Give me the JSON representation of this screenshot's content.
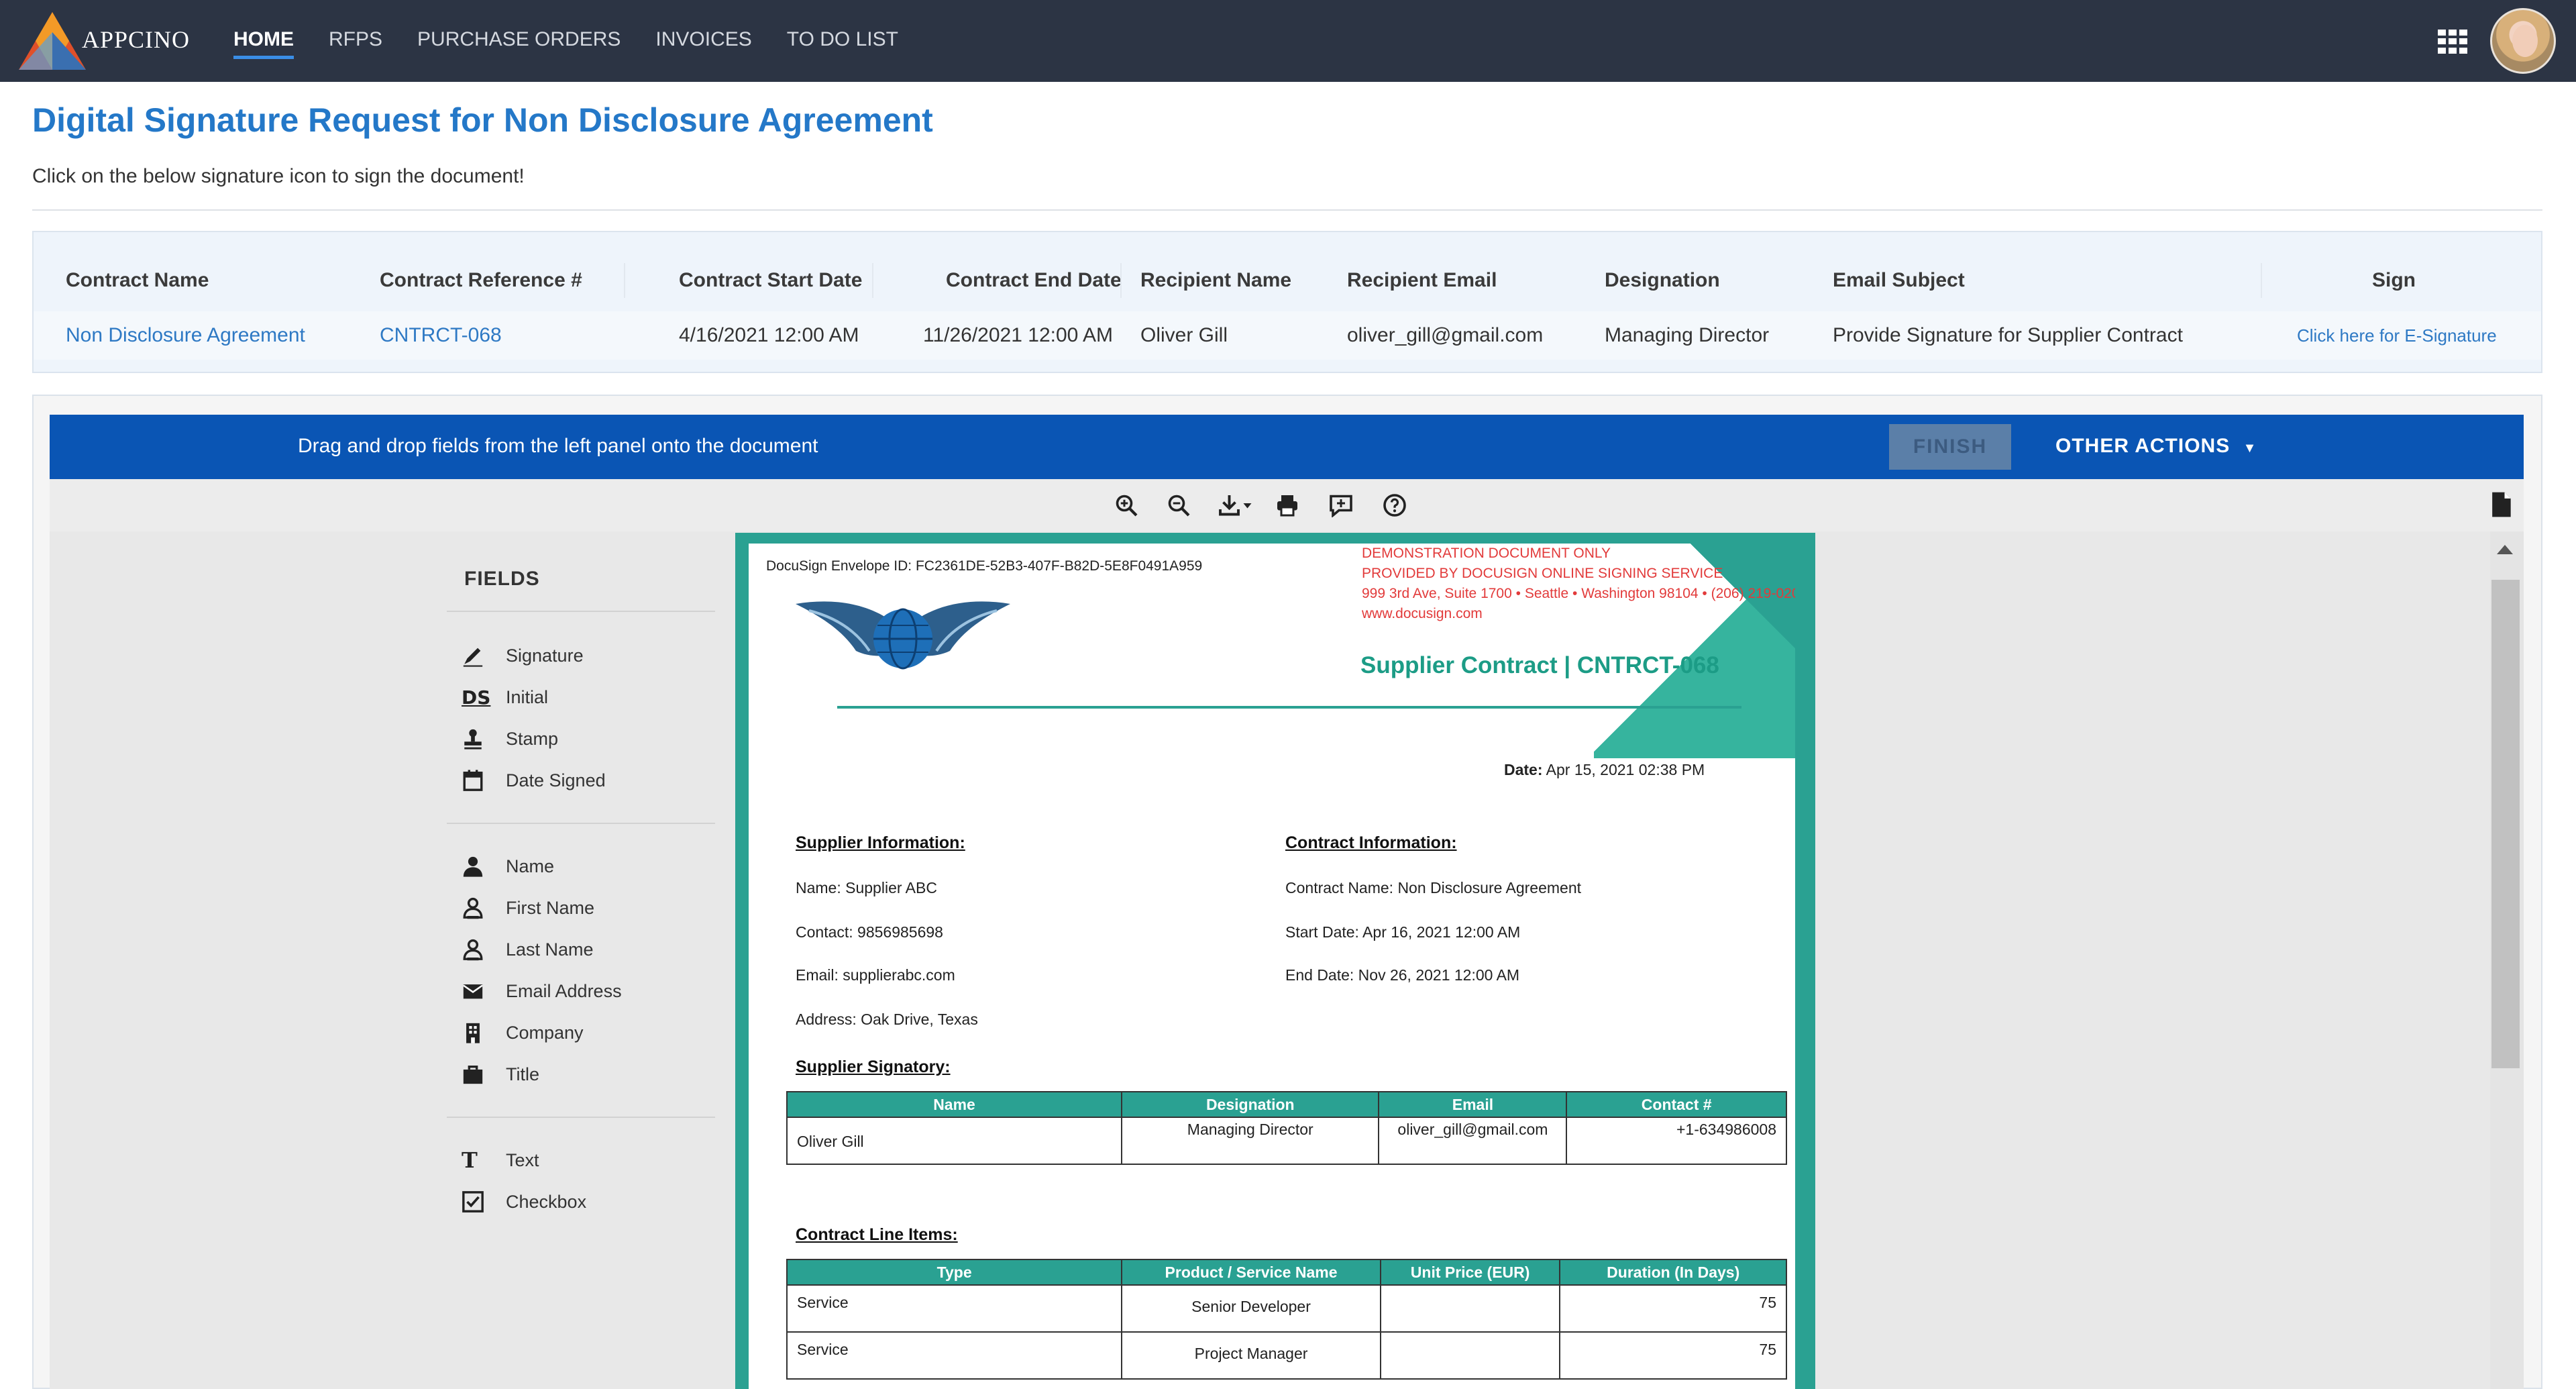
{
  "brand": "APPCINO",
  "nav": [
    {
      "label": "HOME",
      "active": true
    },
    {
      "label": "RFPS"
    },
    {
      "label": "PURCHASE ORDERS"
    },
    {
      "label": "INVOICES"
    },
    {
      "label": "TO DO LIST"
    }
  ],
  "header": {
    "title": "Digital Signature Request for Non Disclosure Agreement",
    "subtitle": "Click on the below signature icon to sign the document!"
  },
  "contract_table": {
    "columns": [
      "Contract Name",
      "Contract Reference #",
      "Contract Start Date",
      "Contract End Date",
      "Recipient Name",
      "Recipient Email",
      "Designation",
      "Email Subject",
      "Sign"
    ],
    "row": {
      "name": "Non Disclosure Agreement",
      "reference": "CNTRCT-068",
      "start": "4/16/2021 12:00 AM",
      "end": "11/26/2021 12:00 AM",
      "recipient": "Oliver Gill",
      "email": "oliver_gill@gmail.com",
      "designation": "Managing Director",
      "subject": "Provide Signature for Supplier Contract",
      "sign": "Click here for E-Signature"
    }
  },
  "docusign": {
    "banner_text": "Drag and drop fields from the left panel onto the document",
    "finish": "FINISH",
    "other_actions": "OTHER ACTIONS",
    "toolbar_icons": [
      "zoom-in-icon",
      "zoom-out-icon",
      "download-icon",
      "print-icon",
      "comment-icon",
      "help-icon"
    ],
    "fields_title": "FIELDS",
    "fields": [
      {
        "label": "Signature",
        "icon": "pen-icon"
      },
      {
        "label": "Initial",
        "icon": "ds-icon"
      },
      {
        "label": "Stamp",
        "icon": "stamp-icon"
      },
      {
        "label": "Date Signed",
        "icon": "calendar-icon"
      },
      {
        "label": "Name",
        "icon": "person-icon"
      },
      {
        "label": "First Name",
        "icon": "person-outline-icon"
      },
      {
        "label": "Last Name",
        "icon": "person-outline-icon"
      },
      {
        "label": "Email Address",
        "icon": "envelope-icon"
      },
      {
        "label": "Company",
        "icon": "building-icon"
      },
      {
        "label": "Title",
        "icon": "briefcase-icon"
      },
      {
        "label": "Text",
        "icon": "text-icon"
      },
      {
        "label": "Checkbox",
        "icon": "checkbox-icon"
      }
    ],
    "ds_glyph": "DS",
    "text_glyph": "T"
  },
  "document": {
    "envelope_id": "DocuSign Envelope ID: FC2361DE-52B3-407F-B82D-5E8F0491A959",
    "demo_lines": [
      "DEMONSTRATION DOCUMENT ONLY",
      "PROVIDED BY DOCUSIGN ONLINE SIGNING SERVICE",
      "999 3rd Ave, Suite 1700  • Seattle • Washington 98104 • (206) 219-0200",
      "www.docusign.com"
    ],
    "title": "Supplier Contract | CNTRCT-068",
    "date_label": "Date:",
    "date_value": "Apr 15, 2021 02:38 PM",
    "supplier_heading": "Supplier Information:",
    "supplier_lines": [
      "Name:  Supplier ABC",
      "Contact: 9856985698",
      "Email: supplierabc.com",
      "Address: Oak Drive, Texas"
    ],
    "contract_heading": "Contract Information:",
    "contract_lines": [
      "Contract Name: Non Disclosure Agreement",
      "Start Date: Apr 16, 2021 12:00 AM",
      "End Date: Nov 26, 2021 12:00 AM"
    ],
    "signatory_heading": "Supplier Signatory:",
    "signatory_columns": [
      "Name",
      "Designation",
      "Email",
      "Contact #"
    ],
    "signatory_row": [
      "Oliver Gill",
      "Managing Director",
      "oliver_gill@gmail.com",
      "+1-634986008"
    ],
    "items_heading": "Contract Line Items:",
    "items_columns": [
      "Type",
      "Product / Service Name",
      "Unit Price (EUR)",
      "Duration (In Days)"
    ],
    "items_rows": [
      [
        "Service",
        "Senior Developer",
        "",
        "75"
      ],
      [
        "Service",
        "Project Manager",
        "",
        "75"
      ]
    ]
  },
  "colors": {
    "nav_bg": "#2c3444",
    "title_blue": "#2478c8",
    "banner_blue": "#0a55b4",
    "teal": "#2aa192",
    "demo_red": "#e23a3a"
  }
}
